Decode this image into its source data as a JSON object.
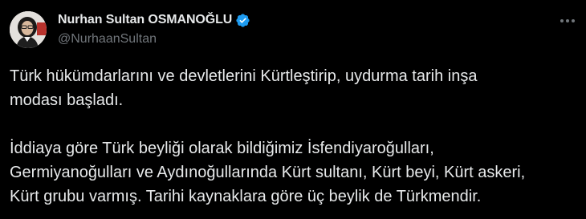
{
  "tweet": {
    "display_name": "Nurhan Sultan OSMANOĞLU",
    "handle": "@NurhaanSultan",
    "verified_icon": "verified-badge-icon",
    "more_icon": "more-horizontal-icon",
    "paragraphs": [
      {
        "lines": [
          "Türk hükümdarlarını ve devletlerini Kürtleştirip, uydurma tarih inşa",
          "modası başladı."
        ]
      },
      {
        "lines": [
          "İddiaya göre Türk beyliği olarak bildiğimiz İsfendiyaroğulları,",
          "Germiyanoğulları ve Aydınoğullarında Kürt sultanı, Kürt beyi, Kürt askeri,",
          "Kürt grubu varmış. Tarihi kaynaklara göre üç beylik de Türkmendir."
        ]
      }
    ]
  },
  "colors": {
    "background": "#000000",
    "text_primary": "#e7e9ea",
    "text_secondary": "#71767b",
    "verified_blue": "#1d9bf0"
  }
}
